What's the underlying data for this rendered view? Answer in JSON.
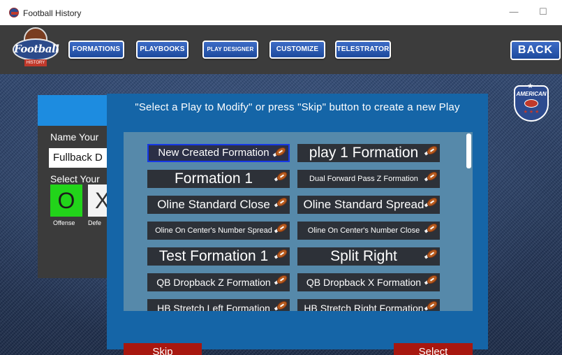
{
  "window": {
    "title": "Football History",
    "minimize_glyph": "—",
    "maximize_glyph": "☐"
  },
  "nav": {
    "logo_text": "Football",
    "logo_sub": "HISTORY",
    "buttons": [
      "FORMATIONS",
      "PLAYBOOKS",
      "PLAY DESIGNER",
      "CUSTOMIZE",
      "TELESTRATOR"
    ],
    "back": "BACK"
  },
  "badge": {
    "text": "AMERICAN"
  },
  "background_panel": {
    "name_label": "Name Your",
    "name_value": "Fullback D",
    "select_label": "Select Your",
    "offense_letter": "O",
    "defense_letter": "X",
    "offense_label": "Offense",
    "defense_label": "Defe"
  },
  "modal": {
    "title": "\"Select a Play to Modify\" or press \"Skip\" button to create a new Play",
    "items": [
      {
        "label": "New Created Formation",
        "selected": true
      },
      {
        "label": "play 1 Formation",
        "selected": false
      },
      {
        "label": "Formation 1",
        "selected": false
      },
      {
        "label": "Dual Forward Pass Z Formation",
        "selected": false
      },
      {
        "label": "Oline Standard Close",
        "selected": false
      },
      {
        "label": "Oline Standard Spread",
        "selected": false
      },
      {
        "label": "Oline On Center's Number Spread",
        "selected": false
      },
      {
        "label": "Oline On Center's Number Close",
        "selected": false
      },
      {
        "label": "Test Formation 1",
        "selected": false
      },
      {
        "label": "Split Right",
        "selected": false
      },
      {
        "label": "QB Dropback Z Formation",
        "selected": false
      },
      {
        "label": "QB Dropback X Formation",
        "selected": false
      },
      {
        "label": "HB Stretch Left Formation",
        "selected": false
      },
      {
        "label": "HB Stretch Right Formation",
        "selected": false
      }
    ],
    "skip_label": "Skip",
    "select_label": "Select"
  },
  "colors": {
    "modal_bg": "#1565a7",
    "list_bg": "#5689aa",
    "item_bg": "#2d3138",
    "selected_border": "#1638e6",
    "action_button": "#a8170f",
    "nav_button": "#1d4a9d",
    "offense_green": "#22d41a"
  },
  "icons": {
    "app": "football-helmet-icon",
    "item_edit": "football-pencil-icon"
  }
}
